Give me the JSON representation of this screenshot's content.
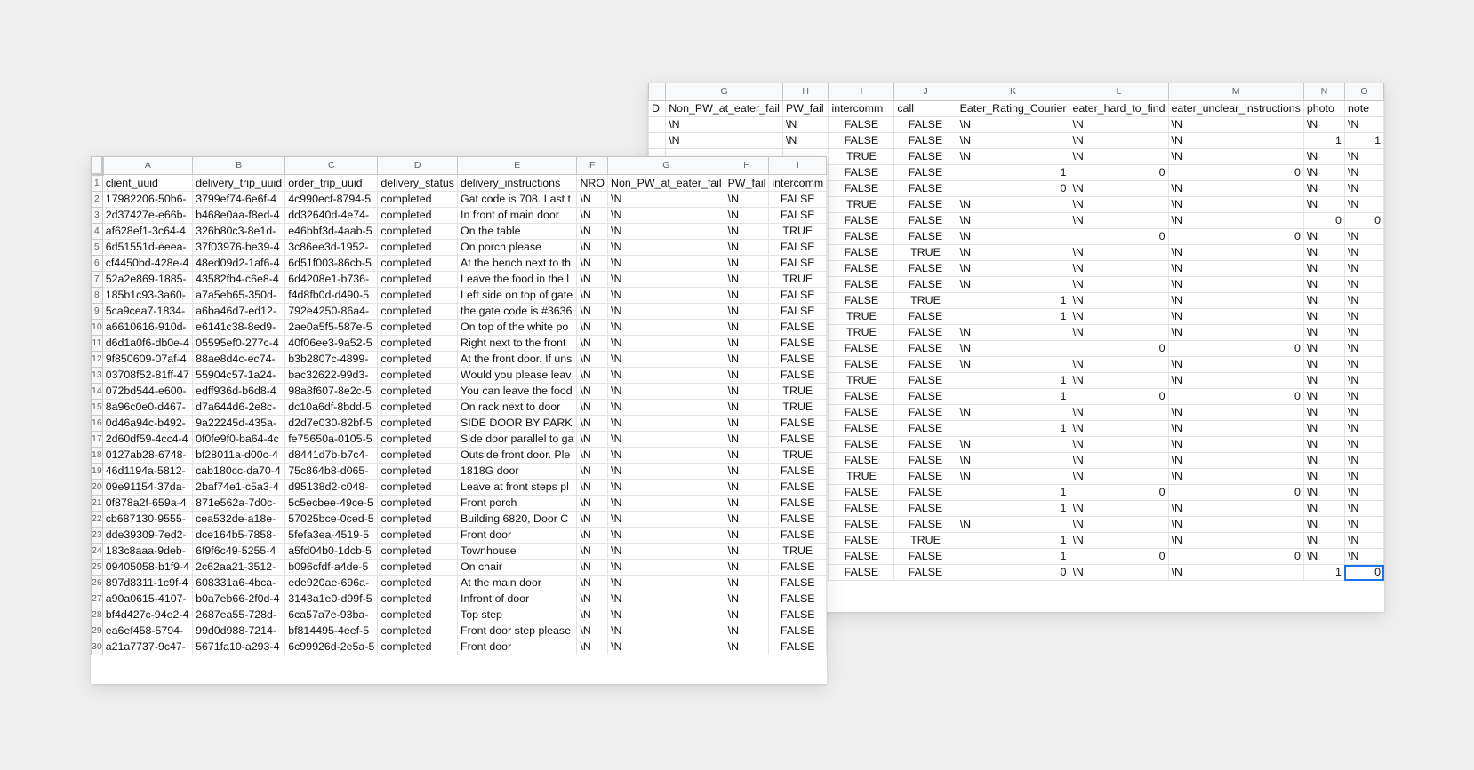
{
  "back_sheet": {
    "col_letters": [
      "",
      "G",
      "H",
      "I",
      "J",
      "K",
      "L",
      "M",
      "N",
      "O"
    ],
    "header_row": [
      "D",
      "Non_PW_at_eater_fail",
      "PW_fail",
      "intercomm",
      "call",
      "Eater_Rating_Courier",
      "eater_hard_to_find",
      "eater_unclear_instructions",
      "photo",
      "note"
    ],
    "rows": [
      [
        "",
        "\\N",
        "\\N",
        "FALSE",
        "FALSE",
        "\\N",
        "\\N",
        "\\N",
        "\\N",
        "\\N"
      ],
      [
        "",
        "\\N",
        "\\N",
        "FALSE",
        "FALSE",
        "\\N",
        "\\N",
        "\\N",
        "1",
        "1"
      ],
      [
        "",
        "",
        "",
        "TRUE",
        "FALSE",
        "\\N",
        "\\N",
        "\\N",
        "\\N",
        "\\N"
      ],
      [
        "",
        "",
        "",
        "FALSE",
        "FALSE",
        "1",
        "0",
        "0",
        "\\N",
        "\\N"
      ],
      [
        "",
        "",
        "",
        "FALSE",
        "FALSE",
        "0",
        "\\N",
        "\\N",
        "\\N",
        "\\N"
      ],
      [
        "",
        "",
        "",
        "TRUE",
        "FALSE",
        "\\N",
        "\\N",
        "\\N",
        "\\N",
        "\\N"
      ],
      [
        "",
        "",
        "",
        "FALSE",
        "FALSE",
        "\\N",
        "\\N",
        "\\N",
        "0",
        "0"
      ],
      [
        "",
        "",
        "",
        "FALSE",
        "FALSE",
        "\\N",
        "0",
        "0",
        "\\N",
        "\\N"
      ],
      [
        "",
        "",
        "",
        "FALSE",
        "TRUE",
        "\\N",
        "\\N",
        "\\N",
        "\\N",
        "\\N"
      ],
      [
        "",
        "",
        "",
        "FALSE",
        "FALSE",
        "\\N",
        "\\N",
        "\\N",
        "\\N",
        "\\N"
      ],
      [
        "",
        "",
        "",
        "FALSE",
        "FALSE",
        "\\N",
        "\\N",
        "\\N",
        "\\N",
        "\\N"
      ],
      [
        "",
        "",
        "",
        "FALSE",
        "TRUE",
        "1",
        "\\N",
        "\\N",
        "\\N",
        "\\N"
      ],
      [
        "",
        "",
        "",
        "TRUE",
        "FALSE",
        "1",
        "\\N",
        "\\N",
        "\\N",
        "\\N"
      ],
      [
        "",
        "",
        "",
        "TRUE",
        "FALSE",
        "\\N",
        "\\N",
        "\\N",
        "\\N",
        "\\N"
      ],
      [
        "",
        "",
        "",
        "FALSE",
        "FALSE",
        "\\N",
        "0",
        "0",
        "\\N",
        "\\N"
      ],
      [
        "",
        "",
        "",
        "FALSE",
        "FALSE",
        "\\N",
        "\\N",
        "\\N",
        "\\N",
        "\\N"
      ],
      [
        "",
        "",
        "",
        "TRUE",
        "FALSE",
        "1",
        "\\N",
        "\\N",
        "\\N",
        "\\N"
      ],
      [
        "",
        "",
        "",
        "FALSE",
        "FALSE",
        "1",
        "0",
        "0",
        "\\N",
        "\\N"
      ],
      [
        "",
        "",
        "",
        "FALSE",
        "FALSE",
        "\\N",
        "\\N",
        "\\N",
        "\\N",
        "\\N"
      ],
      [
        "",
        "",
        "",
        "FALSE",
        "FALSE",
        "1",
        "\\N",
        "\\N",
        "\\N",
        "\\N"
      ],
      [
        "",
        "",
        "",
        "FALSE",
        "FALSE",
        "\\N",
        "\\N",
        "\\N",
        "\\N",
        "\\N"
      ],
      [
        "",
        "",
        "",
        "FALSE",
        "FALSE",
        "\\N",
        "\\N",
        "\\N",
        "\\N",
        "\\N"
      ],
      [
        "",
        "",
        "",
        "TRUE",
        "FALSE",
        "\\N",
        "\\N",
        "\\N",
        "\\N",
        "\\N"
      ],
      [
        "",
        "",
        "",
        "FALSE",
        "FALSE",
        "1",
        "0",
        "0",
        "\\N",
        "\\N"
      ],
      [
        "",
        "",
        "",
        "FALSE",
        "FALSE",
        "1",
        "\\N",
        "\\N",
        "\\N",
        "\\N"
      ],
      [
        "",
        "",
        "",
        "FALSE",
        "FALSE",
        "\\N",
        "\\N",
        "\\N",
        "\\N",
        "\\N"
      ],
      [
        "",
        "",
        "",
        "FALSE",
        "TRUE",
        "1",
        "\\N",
        "\\N",
        "\\N",
        "\\N"
      ],
      [
        "",
        "",
        "",
        "FALSE",
        "FALSE",
        "1",
        "0",
        "0",
        "\\N",
        "\\N"
      ],
      [
        "",
        "",
        "",
        "FALSE",
        "FALSE",
        "0",
        "\\N",
        "\\N",
        "1",
        "0"
      ]
    ]
  },
  "front_sheet": {
    "col_letters": [
      "A",
      "B",
      "C",
      "D",
      "E",
      "F",
      "G",
      "H",
      "I"
    ],
    "header_row": [
      "client_uuid",
      "delivery_trip_uuid",
      "order_trip_uuid",
      "delivery_status",
      "delivery_instructions",
      "NRO",
      "Non_PW_at_eater_fail",
      "PW_fail",
      "intercomm"
    ],
    "rows": [
      [
        "17982206-50b6-",
        "3799ef74-6e6f-4",
        "4c990ecf-8794-5",
        "completed",
        "Gat code is 708. Last t",
        "\\N",
        "\\N",
        "\\N",
        "FALSE"
      ],
      [
        "2d37427e-e66b-",
        "b468e0aa-f8ed-4",
        "dd32640d-4e74-",
        "completed",
        "In front of main door",
        "\\N",
        "\\N",
        "\\N",
        "FALSE"
      ],
      [
        "af628ef1-3c64-4",
        "326b80c3-8e1d-",
        "e46bbf3d-4aab-5",
        "completed",
        "On the table",
        "\\N",
        "\\N",
        "\\N",
        "TRUE"
      ],
      [
        "6d51551d-eeea-",
        "37f03976-be39-4",
        "3c86ee3d-1952-",
        "completed",
        "On porch please",
        "\\N",
        "\\N",
        "\\N",
        "FALSE"
      ],
      [
        "cf4450bd-428e-4",
        "48ed09d2-1af6-4",
        "6d51f003-86cb-5",
        "completed",
        "At the bench next to th",
        "\\N",
        "\\N",
        "\\N",
        "FALSE"
      ],
      [
        "52a2e869-1885-",
        "43582fb4-c6e8-4",
        "6d4208e1-b736-",
        "completed",
        "Leave the food in the l",
        "\\N",
        "\\N",
        "\\N",
        "TRUE"
      ],
      [
        "185b1c93-3a60-",
        "a7a5eb65-350d-",
        "f4d8fb0d-d490-5",
        "completed",
        "Left side on top of gate",
        "\\N",
        "\\N",
        "\\N",
        "FALSE"
      ],
      [
        "5ca9cea7-1834-",
        "a6ba46d7-ed12-",
        "792e4250-86a4-",
        "completed",
        "the gate code is #3636",
        "\\N",
        "\\N",
        "\\N",
        "FALSE"
      ],
      [
        "a6610616-910d-",
        "e6141c38-8ed9-",
        "2ae0a5f5-587e-5",
        "completed",
        "On top of the white po",
        "\\N",
        "\\N",
        "\\N",
        "FALSE"
      ],
      [
        "d6d1a0f6-db0e-4",
        "05595ef0-277c-4",
        "40f06ee3-9a52-5",
        "completed",
        "Right next to the front",
        "\\N",
        "\\N",
        "\\N",
        "FALSE"
      ],
      [
        "9f850609-07af-4",
        "88ae8d4c-ec74-",
        "b3b2807c-4899-",
        "completed",
        "At the front door. If uns",
        "\\N",
        "\\N",
        "\\N",
        "FALSE"
      ],
      [
        "03708f52-81ff-47",
        "55904c57-1a24-",
        "bac32622-99d3-",
        "completed",
        "Would you please leav",
        "\\N",
        "\\N",
        "\\N",
        "FALSE"
      ],
      [
        "072bd544-e600-",
        "edff936d-b6d8-4",
        "98a8f607-8e2c-5",
        "completed",
        "You can leave the food",
        "\\N",
        "\\N",
        "\\N",
        "TRUE"
      ],
      [
        "8a96c0e0-d467-",
        "d7a644d6-2e8c-",
        "dc10a6df-8bdd-5",
        "completed",
        "On rack next to door",
        "\\N",
        "\\N",
        "\\N",
        "TRUE"
      ],
      [
        "0d46a94c-b492-",
        "9a22245d-435a-",
        "d2d7e030-82bf-5",
        "completed",
        "SIDE DOOR BY PARK",
        "\\N",
        "\\N",
        "\\N",
        "FALSE"
      ],
      [
        "2d60df59-4cc4-4",
        "0f0fe9f0-ba64-4c",
        "fe75650a-0105-5",
        "completed",
        "Side door parallel to ga",
        "\\N",
        "\\N",
        "\\N",
        "FALSE"
      ],
      [
        "0127ab28-6748-",
        "bf28011a-d00c-4",
        "d8441d7b-b7c4-",
        "completed",
        "Outside front door.  Ple",
        "\\N",
        "\\N",
        "\\N",
        "TRUE"
      ],
      [
        "46d1194a-5812-",
        "cab180cc-da70-4",
        "75c864b8-d065-",
        "completed",
        "1818G door",
        "\\N",
        "\\N",
        "\\N",
        "FALSE"
      ],
      [
        "09e91154-37da-",
        "2baf74e1-c5a3-4",
        "d95138d2-c048-",
        "completed",
        "Leave at front steps pl",
        "\\N",
        "\\N",
        "\\N",
        "FALSE"
      ],
      [
        "0f878a2f-659a-4",
        "871e562a-7d0c-",
        "5c5ecbee-49ce-5",
        "completed",
        "Front porch",
        "\\N",
        "\\N",
        "\\N",
        "FALSE"
      ],
      [
        "cb687130-9555-",
        "cea532de-a18e-",
        "57025bce-0ced-5",
        "completed",
        "Building 6820, Door C",
        "\\N",
        "\\N",
        "\\N",
        "FALSE"
      ],
      [
        "dde39309-7ed2-",
        "dce164b5-7858-",
        "5fefa3ea-4519-5",
        "completed",
        "Front door",
        "\\N",
        "\\N",
        "\\N",
        "FALSE"
      ],
      [
        "183c8aaa-9deb-",
        "6f9f6c49-5255-4",
        "a5fd04b0-1dcb-5",
        "completed",
        "Townhouse",
        "\\N",
        "\\N",
        "\\N",
        "TRUE"
      ],
      [
        "09405058-b1f9-4",
        "2c62aa21-3512-",
        "b096cfdf-a4de-5",
        "completed",
        "On chair",
        "\\N",
        "\\N",
        "\\N",
        "FALSE"
      ],
      [
        "897d8311-1c9f-4",
        "608331a6-4bca-",
        "ede920ae-696a-",
        "completed",
        "At the main door",
        "\\N",
        "\\N",
        "\\N",
        "FALSE"
      ],
      [
        "a90a0615-4107-",
        "b0a7eb66-2f0d-4",
        "3143a1e0-d99f-5",
        "completed",
        "Infront of door",
        "\\N",
        "\\N",
        "\\N",
        "FALSE"
      ],
      [
        "bf4d427c-94e2-4",
        "2687ea55-728d-",
        "6ca57a7e-93ba-",
        "completed",
        "Top step",
        "\\N",
        "\\N",
        "\\N",
        "FALSE"
      ],
      [
        "ea6ef458-5794-",
        "99d0d988-7214-",
        "bf814495-4eef-5",
        "completed",
        "Front door step please",
        "\\N",
        "\\N",
        "\\N",
        "FALSE"
      ],
      [
        "a21a7737-9c47-",
        "5671fa10-a293-4",
        "6c99926d-2e5a-5",
        "completed",
        "Front door",
        "\\N",
        "\\N",
        "\\N",
        "FALSE"
      ]
    ]
  }
}
